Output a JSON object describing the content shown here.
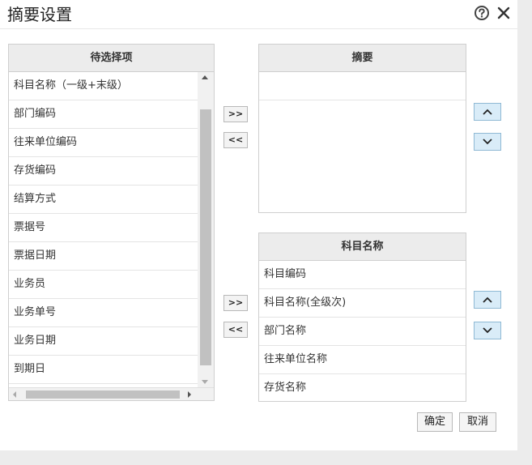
{
  "dialog": {
    "title": "摘要设置",
    "help_icon": "help-icon",
    "close_icon": "close-icon"
  },
  "available": {
    "header": "待选择项",
    "items": [
      {
        "label": "科目名称（一级+末级）"
      },
      {
        "label": "部门编码"
      },
      {
        "label": "往来单位编码"
      },
      {
        "label": "存货编码"
      },
      {
        "label": "结算方式"
      },
      {
        "label": "票据号"
      },
      {
        "label": "票据日期"
      },
      {
        "label": "业务员"
      },
      {
        "label": "业务单号"
      },
      {
        "label": "业务日期"
      },
      {
        "label": "到期日"
      }
    ]
  },
  "summary": {
    "header": "摘要",
    "items": []
  },
  "subject_name": {
    "header": "科目名称",
    "items": [
      {
        "label": "科目编码"
      },
      {
        "label": "科目名称(全级次)"
      },
      {
        "label": "部门名称"
      },
      {
        "label": "往来单位名称"
      },
      {
        "label": "存货名称"
      }
    ]
  },
  "transfer": {
    "add_label": ">>",
    "remove_label": "<<"
  },
  "footer": {
    "ok_label": "确定",
    "cancel_label": "取消"
  },
  "colors": {
    "accent_button_bg": "#d9ecf8",
    "accent_button_border": "#8fb9d4",
    "header_bg": "#ececec"
  }
}
